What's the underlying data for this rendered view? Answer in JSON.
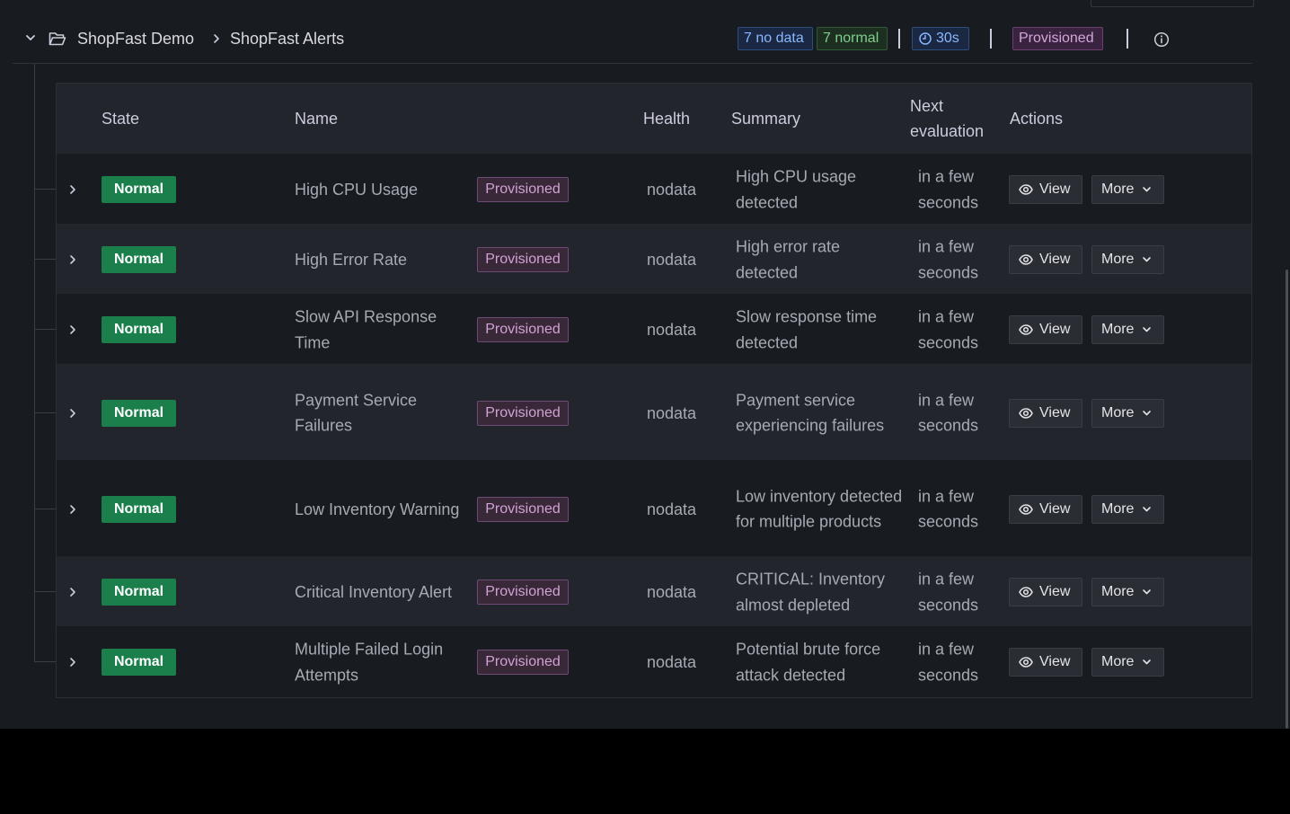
{
  "group": {
    "folder": "ShopFast Demo",
    "name": "ShopFast Alerts",
    "counts": {
      "nodata": "7 no data",
      "normal": "7 normal"
    },
    "interval": "30s",
    "provisioned": "Provisioned"
  },
  "columns": {
    "state": "State",
    "name": "Name",
    "health": "Health",
    "summary": "Summary",
    "next_eval": "Next evaluation",
    "actions": "Actions"
  },
  "rows": [
    {
      "state": "Normal",
      "name": "High CPU Usage",
      "tag": "Provisioned",
      "health": "nodata",
      "summary": "High CPU usage detected",
      "next_eval": "in a few seconds",
      "view": "View",
      "more": "More"
    },
    {
      "state": "Normal",
      "name": "High Error Rate",
      "tag": "Provisioned",
      "health": "nodata",
      "summary": "High error rate detected",
      "next_eval": "in a few seconds",
      "view": "View",
      "more": "More"
    },
    {
      "state": "Normal",
      "name": "Slow API Response Time",
      "tag": "Provisioned",
      "health": "nodata",
      "summary": "Slow response time detected",
      "next_eval": "in a few seconds",
      "view": "View",
      "more": "More"
    },
    {
      "state": "Normal",
      "name": "Payment Service Failures",
      "tag": "Provisioned",
      "health": "nodata",
      "summary": "Payment service experiencing failures",
      "next_eval": "in a few seconds",
      "view": "View",
      "more": "More"
    },
    {
      "state": "Normal",
      "name": "Low Inventory Warning",
      "tag": "Provisioned",
      "health": "nodata",
      "summary": "Low inventory detected for multiple products",
      "next_eval": "in a few seconds",
      "view": "View",
      "more": "More"
    },
    {
      "state": "Normal",
      "name": "Critical Inventory Alert",
      "tag": "Provisioned",
      "health": "nodata",
      "summary": "CRITICAL: Inventory almost depleted",
      "next_eval": "in a few seconds",
      "view": "View",
      "more": "More"
    },
    {
      "state": "Normal",
      "name": "Multiple Failed Login Attempts",
      "tag": "Provisioned",
      "health": "nodata",
      "summary": "Potential brute force attack detected",
      "next_eval": "in a few seconds",
      "view": "View",
      "more": "More"
    }
  ],
  "colors": {
    "background": "#181b1f",
    "state_normal": "#1a7f4b",
    "provisioned_bg": "#392838",
    "nodata_accent": "#8ab8ff",
    "normal_accent": "#7fcf8e"
  },
  "icons": {
    "collapse": "chevron-down-icon",
    "folder": "folder-open-icon",
    "breadcrumb": "chevron-right-icon",
    "interval": "clock-icon",
    "info": "info-circle-icon",
    "expand_row": "chevron-right-icon",
    "view": "eye-icon",
    "more": "chevron-down-icon"
  }
}
